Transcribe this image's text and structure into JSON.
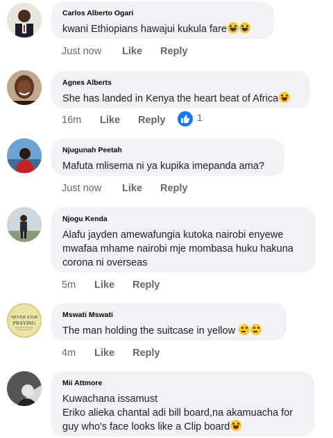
{
  "comments": [
    {
      "author": "Carlos Alberto Ogari",
      "text": "kwani Ethiopians hawajui kukula fare",
      "emoji": [
        "laugh-cry-emoji",
        "laugh-cry-emoji"
      ],
      "time": "Just now",
      "like": "Like",
      "reply": "Reply"
    },
    {
      "author": "Agnes Alberts",
      "text": "She has landed in Kenya the heart beat of Africa",
      "emoji": [
        "grin-emoji"
      ],
      "time": "16m",
      "like": "Like",
      "reply": "Reply",
      "reaction_count": "1"
    },
    {
      "author": "Njugunah Peetah",
      "text": "Mafuta mlisema ni ya kupika imepanda ama?",
      "time": "Just now",
      "like": "Like",
      "reply": "Reply"
    },
    {
      "author": "Njogu Kenda",
      "text_lines": [
        "Alafu jayden amewafungia kutoka nairobi enyewe",
        "mwafaa mhame nairobi mje mombasa huku hakuna",
        "corona ni overseas"
      ],
      "time": "5m",
      "like": "Like",
      "reply": "Reply"
    },
    {
      "author": "Mswati Mswati",
      "text": "The man holding the suitcase in yellow",
      "emoji": [
        "thinking-emoji",
        "thinking-emoji"
      ],
      "time": "4m",
      "like": "Like",
      "reply": "Reply",
      "avatar_text": [
        "NEVER STOP",
        "PRAYING"
      ]
    },
    {
      "author": "Mii Attmore",
      "text_lines": [
        "Kuwachana issamust",
        "Eriko alieka chantal adi bill board,na akamuacha for",
        "guy who's face looks like a Clip board"
      ],
      "emoji_last_line": [
        "smile-emoji"
      ]
    }
  ],
  "colors": {
    "bubble": "#f0f2f5",
    "meta": "#65676b",
    "like_blue": "#1877f2"
  }
}
